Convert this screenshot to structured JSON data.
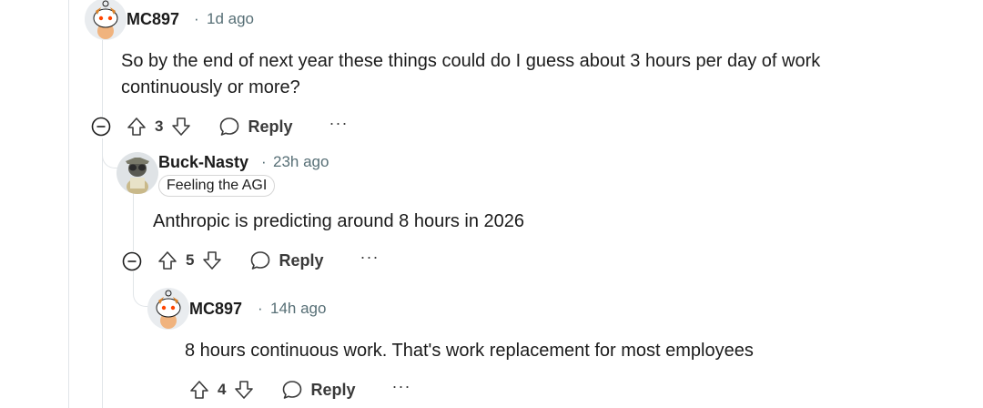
{
  "comments": [
    {
      "username": "MC897",
      "separator": "·",
      "time": "1d ago",
      "body": "So by the end of next year these things could do I guess about 3 hours per day of work continuously or more?",
      "votes": "3",
      "reply_label": "Reply",
      "more": "···"
    },
    {
      "username": "Buck-Nasty",
      "separator": "·",
      "time": "23h ago",
      "flair": "Feeling the AGI",
      "body": "Anthropic is predicting around 8 hours in 2026",
      "votes": "5",
      "reply_label": "Reply",
      "more": "···"
    },
    {
      "username": "MC897",
      "separator": "·",
      "time": "14h ago",
      "body": "8 hours continuous work. That's work replacement for most employees",
      "votes": "4",
      "reply_label": "Reply",
      "more": "···"
    }
  ],
  "colors": {
    "text": "#1c1c1c",
    "meta": "#576f76",
    "thread_line": "#e1e5e8",
    "action": "#3a3a3a"
  }
}
